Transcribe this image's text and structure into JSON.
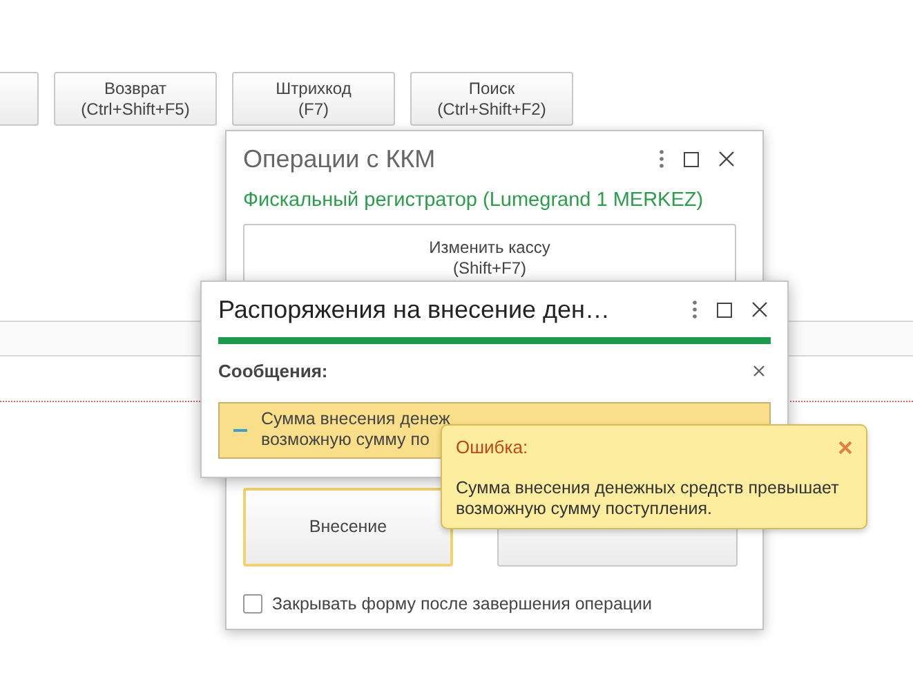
{
  "toolbar": {
    "buttons": [
      {
        "label": "Возврат",
        "shortcut": "(Ctrl+Shift+F5)"
      },
      {
        "label": "Штрихкод",
        "shortcut": "(F7)"
      },
      {
        "label": "Поиск",
        "shortcut": "(Ctrl+Shift+F2)"
      }
    ]
  },
  "kkm_window": {
    "title": "Операции с ККМ",
    "device": "Фискальный регистратор (Lumegrand 1 MERKEZ)",
    "change_button": {
      "label": "Изменить кассу",
      "shortcut": "(Shift+F7)"
    },
    "operation_buttons": [
      {
        "label": "Внесение",
        "selected": true
      },
      {
        "selected": false
      }
    ],
    "close_checkbox": {
      "label": "Закрывать форму после завершения операции",
      "checked": false
    }
  },
  "order_window": {
    "title": "Распоряжения на внесение ден…",
    "progress": {
      "level": 1
    },
    "messages_label": "Сообщения:",
    "message_lines": [
      "Сумма внесения денеж",
      "возможную сумму по"
    ]
  },
  "tooltip": {
    "title": "Ошибка:",
    "text": "Сумма внесения денежных средств превышает возможную сумму поступления."
  }
}
